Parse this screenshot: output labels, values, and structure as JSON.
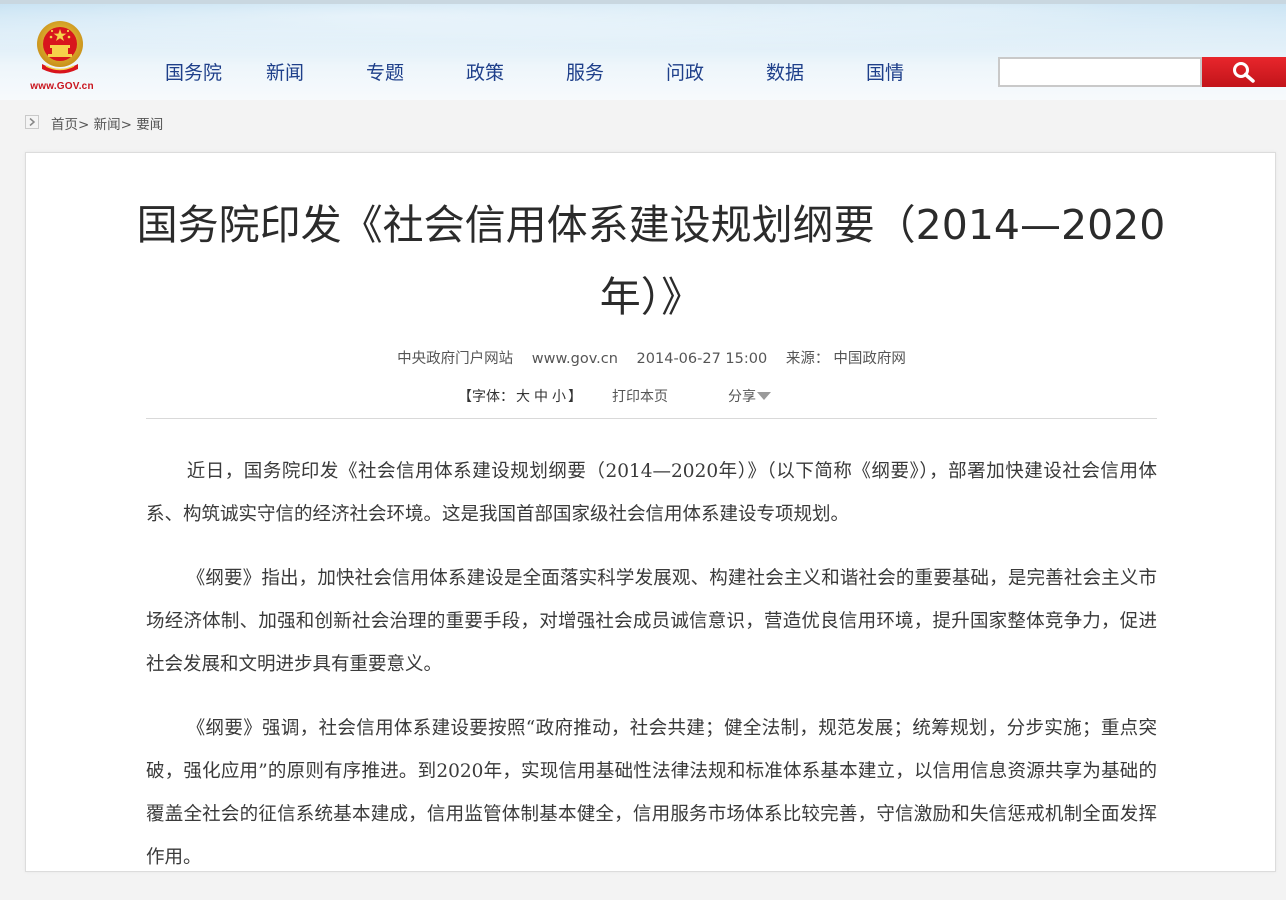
{
  "header": {
    "logo_text": "www.GOV.cn",
    "nav": [
      "国务院",
      "新闻",
      "专题",
      "政策",
      "服务",
      "问政",
      "数据",
      "国情"
    ],
    "search": {
      "placeholder": "",
      "value": ""
    }
  },
  "breadcrumb": {
    "items": [
      "首页",
      "新闻",
      "要闻"
    ],
    "separator": ">"
  },
  "article": {
    "title": "国务院印发《社会信用体系建设规划纲要（2014—2020年）》",
    "meta": {
      "site": "中央政府门户网站",
      "url": "www.gov.cn",
      "datetime": "2014-06-27 15:00",
      "source_label": "来源：",
      "source": "中国政府网"
    },
    "tools": {
      "font_label": "【字体：",
      "font_large": "大",
      "font_medium": "中",
      "font_small": "小",
      "font_close": "】",
      "print": "打印本页",
      "share": "分享"
    },
    "paragraphs": [
      "近日，国务院印发《社会信用体系建设规划纲要（2014—2020年）》（以下简称《纲要》），部署加快建设社会信用体系、构筑诚实守信的经济社会环境。这是我国首部国家级社会信用体系建设专项规划。",
      "《纲要》指出，加快社会信用体系建设是全面落实科学发展观、构建社会主义和谐社会的重要基础，是完善社会主义市场经济体制、加强和创新社会治理的重要手段，对增强社会成员诚信意识，营造优良信用环境，提升国家整体竞争力，促进社会发展和文明进步具有重要意义。",
      "《纲要》强调，社会信用体系建设要按照“政府推动，社会共建；健全法制，规范发展；统筹规划，分步实施；重点突破，强化应用”的原则有序推进。到2020年，实现信用基础性法律法规和标准体系基本建立，以信用信息资源共享为基础的覆盖全社会的征信系统基本建成，信用监管体制基本健全，信用服务市场体系比较完善，守信激励和失信惩戒机制全面发挥作用。"
    ]
  },
  "colors": {
    "nav": "#1e3f8a",
    "search_button": "#d21d23",
    "logo_red": "#c9151e"
  },
  "icons": {
    "search": "magnifier-icon",
    "emblem": "national-emblem-icon",
    "breadcrumb": "chevron-right-icon",
    "share": "caret-down-icon"
  }
}
